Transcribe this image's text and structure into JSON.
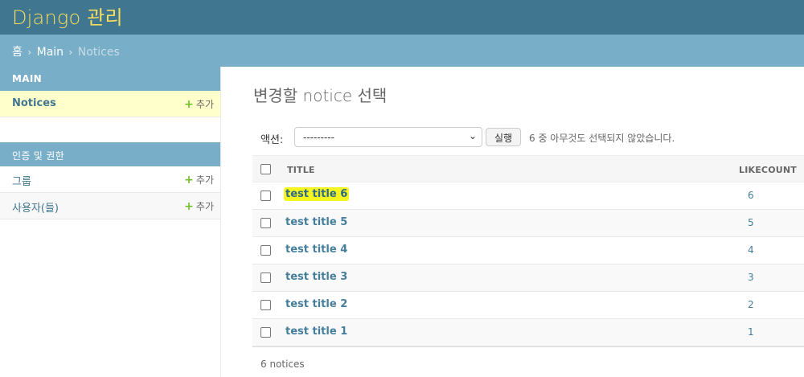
{
  "header": {
    "branding": "Django 관리"
  },
  "breadcrumbs": {
    "home": "홈",
    "sep": "›",
    "app": "Main",
    "current": "Notices"
  },
  "sidebar": {
    "modules": [
      {
        "caption": "MAIN",
        "items": [
          {
            "label": "Notices",
            "add_label": "추가"
          }
        ]
      },
      {
        "caption": "인증 및 권한",
        "items": [
          {
            "label": "그룹",
            "add_label": "추가"
          },
          {
            "label": "사용자(들)",
            "add_label": "추가"
          }
        ]
      }
    ]
  },
  "content": {
    "title": "변경할 notice 선택",
    "actions": {
      "label": "액션:",
      "selected_option": "---------",
      "run_label": "실행",
      "counter": "6 중 아무것도 선택되지 않았습니다."
    },
    "table": {
      "headers": [
        "TITLE",
        "LIKECOUNT"
      ],
      "rows": [
        {
          "title": "test title 6",
          "likecount": "6"
        },
        {
          "title": "test title 5",
          "likecount": "5"
        },
        {
          "title": "test title 4",
          "likecount": "4"
        },
        {
          "title": "test title 3",
          "likecount": "3"
        },
        {
          "title": "test title 2",
          "likecount": "2"
        },
        {
          "title": "test title 1",
          "likecount": "1"
        }
      ]
    },
    "paginator": "6 notices"
  },
  "colors": {
    "header_bg": "#417690",
    "branding": "#f5dd5d",
    "breadcrumb_bg": "#79aec8",
    "link": "#447e9b",
    "highlight": "#f5f520",
    "current_row": "#ffffcc",
    "add_icon": "#70bf2b"
  },
  "icons": {
    "add": "plus-icon",
    "select": "chevron-down-icon"
  }
}
